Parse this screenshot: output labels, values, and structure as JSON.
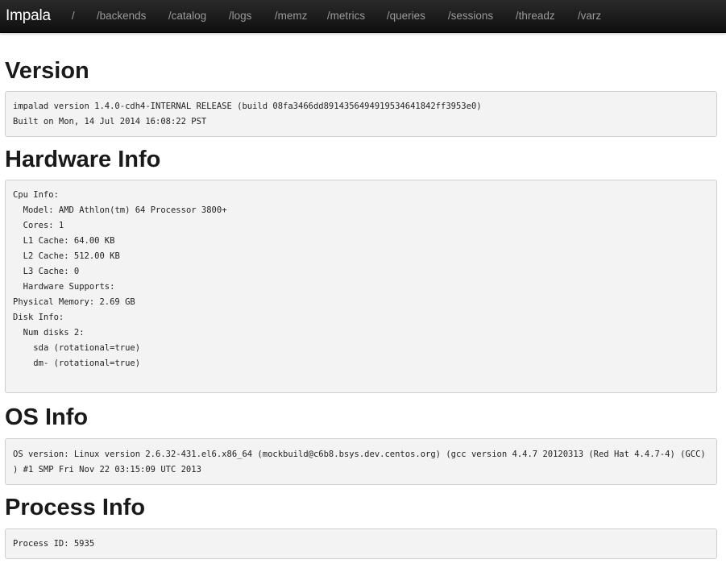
{
  "navbar": {
    "brand": "Impala",
    "links": [
      "/",
      "/backends",
      "/catalog",
      "/logs",
      "/memz",
      "/metrics",
      "/queries",
      "/sessions",
      "/threadz",
      "/varz"
    ]
  },
  "sections": {
    "version": {
      "title": "Version",
      "lines": [
        "impalad version 1.4.0-cdh4-INTERNAL RELEASE (build 08fa3466dd8914356494919534641842ff3953e0)",
        "Built on Mon, 14 Jul 2014 16:08:22 PST"
      ]
    },
    "hardware": {
      "title": "Hardware Info",
      "lines": [
        "Cpu Info:",
        "  Model: AMD Athlon(tm) 64 Processor 3800+",
        "  Cores: 1",
        "  L1 Cache: 64.00 KB",
        "  L2 Cache: 512.00 KB",
        "  L3 Cache: 0",
        "  Hardware Supports:",
        "Physical Memory: 2.69 GB",
        "Disk Info:",
        "  Num disks 2:",
        "    sda (rotational=true)",
        "    dm- (rotational=true)"
      ]
    },
    "os": {
      "title": "OS Info",
      "lines": [
        "OS version: Linux version 2.6.32-431.el6.x86_64 (mockbuild@c6b8.bsys.dev.centos.org) (gcc version 4.4.7 20120313 (Red Hat 4.4.7-4) (GCC) ) #1 SMP Fri Nov 22 03:15:09 UTC 2013"
      ]
    },
    "process": {
      "title": "Process Info",
      "lines": [
        "Process ID: 5935"
      ]
    }
  }
}
